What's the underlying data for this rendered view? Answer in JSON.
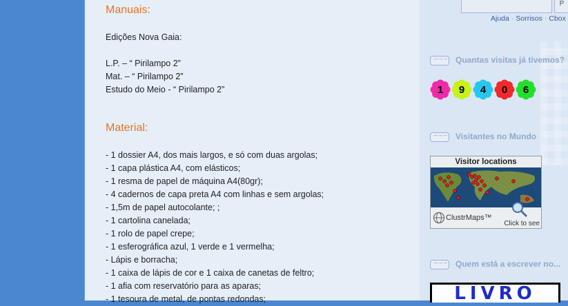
{
  "post": {
    "manuais_heading": "Manuais:",
    "manuais_lines": [
      "Edições Nova Gaia:",
      "",
      "L.P. – “ Pirilampo 2”",
      "Mat. – “ Pirilampo 2”",
      "Estudo do Meio - “ Pirilampo 2”"
    ],
    "material_heading": "Material:",
    "material_lines": [
      "- 1 dossier A4, dos mais largos, e só com duas argolas;",
      "- 1 capa plástica A4, com elásticos;",
      "- 1 resma de papel de máquina A4(80gr);",
      "- 4 cadernos de capa preta A4 com linhas e sem argolas;",
      "- 1,5m de papel autocolante; ;",
      "- 1 cartolina canelada;",
      "- 1 rolo de papel crepe;",
      "- 1 esferográfica azul, 1 verde e 1 vermelha;",
      "- Lápis e borracha;",
      "- 1 caixa de lápis de cor e 1 caixa de canetas de feltro;",
      "- 1 afia com reservatório para as aparas;",
      "- 1 tesoura de metal, de pontas redondas;"
    ]
  },
  "sidebar": {
    "cbox_links": [
      "Ajuda",
      "Sorrisos",
      "Cbox"
    ],
    "cbox_button": "P",
    "visits_title": "Quantas visitas já tivemos?",
    "counter_digits": [
      "1",
      "9",
      "4",
      "0",
      "6"
    ],
    "counter_colors": [
      "#f02aa8",
      "#c8f21a",
      "#22c8f0",
      "#f02a2a",
      "#22e02a"
    ],
    "world_title": "Visitantes no Mundo",
    "map_title": "Visitor locations",
    "map_brand": "ClustrMaps™",
    "map_click": "Click to see",
    "writers_title": "Quem está a escrever no...",
    "livro_text": "LIVRO"
  },
  "colors": {
    "heading": "#e8741d",
    "page_bg": "#4a87d0",
    "post_bg": "#e6eef8"
  }
}
